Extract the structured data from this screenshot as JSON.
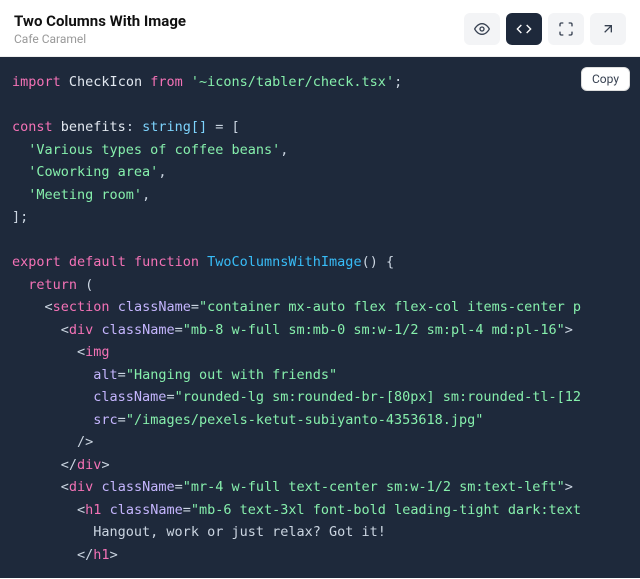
{
  "header": {
    "title": "Two Columns With Image",
    "subtitle": "Cafe Caramel"
  },
  "toolbar": {
    "preview_icon": "eye-icon",
    "code_icon": "code-icon",
    "expand_icon": "expand-icon",
    "open_icon": "external-link-icon"
  },
  "copy_label": "Copy",
  "code": {
    "l1_import": "import",
    "l1_ident": "CheckIcon",
    "l1_from": "from",
    "l1_path": "'~icons/tabler/check.tsx'",
    "l1_semi": ";",
    "l3_const": "const",
    "l3_name": "benefits",
    "l3_colon": ":",
    "l3_type": "string[]",
    "l3_eq": " = [",
    "l4": "'Various types of coffee beans'",
    "l4c": ",",
    "l5": "'Coworking area'",
    "l5c": ",",
    "l6": "'Meeting room'",
    "l6c": ",",
    "l7": "];",
    "l9_export": "export",
    "l9_default": "default",
    "l9_function": "function",
    "l9_fnname": "TwoColumnsWithImage",
    "l9_paren": "() {",
    "l10_return": "return",
    "l10_paren": " (",
    "l11_open": "<",
    "l11_tag": "section",
    "l11_attr": "className",
    "l11_eq": "=",
    "l11_val": "\"container mx-auto flex flex-col items-center p",
    "l12_open": "<",
    "l12_tag": "div",
    "l12_attr": "className",
    "l12_eq": "=",
    "l12_val": "\"mb-8 w-full sm:mb-0 sm:w-1/2 sm:pl-4 md:pl-16\"",
    "l12_close": ">",
    "l13_open": "<",
    "l13_tag": "img",
    "l14_attr": "alt",
    "l14_eq": "=",
    "l14_val": "\"Hanging out with friends\"",
    "l15_attr": "className",
    "l15_eq": "=",
    "l15_val": "\"rounded-lg sm:rounded-br-[80px] sm:rounded-tl-[12",
    "l16_attr": "src",
    "l16_eq": "=",
    "l16_val": "\"/images/pexels-ketut-subiyanto-4353618.jpg\"",
    "l17": "/>",
    "l18_open": "</",
    "l18_tag": "div",
    "l18_close": ">",
    "l19_open": "<",
    "l19_tag": "div",
    "l19_attr": "className",
    "l19_eq": "=",
    "l19_val": "\"mr-4 w-full text-center sm:w-1/2 sm:text-left\"",
    "l19_close": ">",
    "l20_open": "<",
    "l20_tag": "h1",
    "l20_attr": "className",
    "l20_eq": "=",
    "l20_val": "\"mb-6 text-3xl font-bold leading-tight dark:text",
    "l21": "Hangout, work or just relax? Got it!",
    "l22_open": "</",
    "l22_tag": "h1",
    "l22_close": ">"
  }
}
